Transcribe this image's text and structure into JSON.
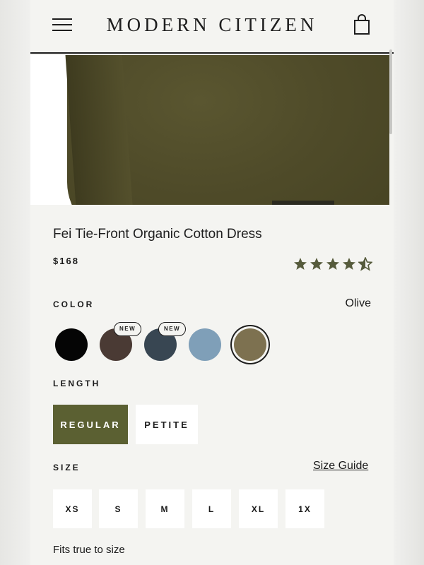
{
  "brand": "MODERN CITIZEN",
  "product": {
    "title": "Fei Tie-Front Organic Cotton Dress",
    "price": "$168",
    "rating": 4.5
  },
  "color": {
    "label": "COLOR",
    "selected_name": "Olive",
    "swatches": [
      {
        "hex": "#050505",
        "badge": ""
      },
      {
        "hex": "#4a3a34",
        "badge": "NEW"
      },
      {
        "hex": "#384652",
        "badge": "NEW"
      },
      {
        "hex": "#7f9fb8",
        "badge": ""
      },
      {
        "hex": "#7d7150",
        "badge": ""
      }
    ]
  },
  "length": {
    "label": "LENGTH",
    "options": [
      "REGULAR",
      "PETITE"
    ],
    "selected": "REGULAR"
  },
  "size": {
    "label": "SIZE",
    "guide_label": "Size Guide",
    "options": [
      "XS",
      "S",
      "M",
      "L",
      "XL",
      "1X"
    ]
  },
  "fit_note": "Fits true to size",
  "colors": {
    "accent": "#5b6032",
    "star": "#565b3c",
    "background": "#f4f4f1"
  },
  "icons": {
    "menu": "hamburger-menu-icon",
    "bag": "shopping-bag-icon",
    "star": "star-icon"
  }
}
